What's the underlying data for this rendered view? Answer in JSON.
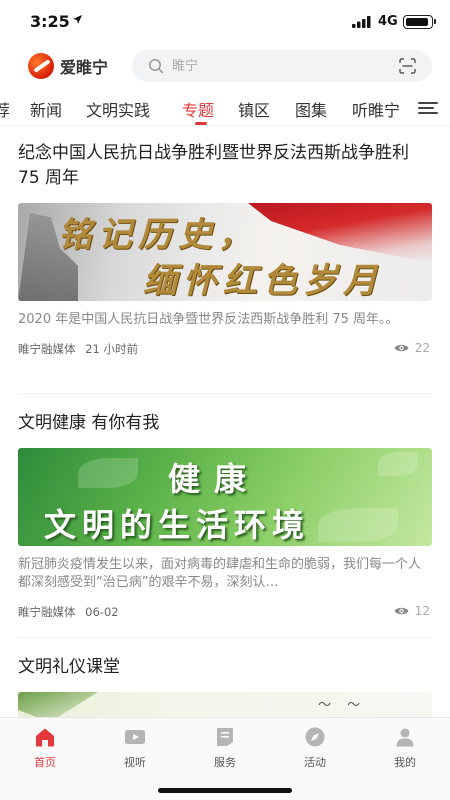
{
  "status_bar": {
    "time": "3:25",
    "network": "4G"
  },
  "header": {
    "logo_text": "爱睢宁",
    "search": {
      "placeholder": "睢宁"
    }
  },
  "tabs": [
    {
      "label": "荐",
      "active": false
    },
    {
      "label": "新闻",
      "active": false
    },
    {
      "label": "文明实践",
      "active": false
    },
    {
      "label": "专题",
      "active": true
    },
    {
      "label": "镇区",
      "active": false
    },
    {
      "label": "图集",
      "active": false
    },
    {
      "label": "听睢宁",
      "active": false
    }
  ],
  "articles": [
    {
      "title": "纪念中国人民抗日战争胜利暨世界反法西斯战争胜利 75 周年",
      "image_text": [
        "铭记历史，",
        "缅怀红色岁月"
      ],
      "description": "2020 年是中国人民抗日战争暨世界反法西斯战争胜利 75 周年。。",
      "source": "睢宁融媒体",
      "time": "21 小时前",
      "views": "22"
    },
    {
      "title": "文明健康 有你有我",
      "image_text": [
        "健康",
        "文明的生活环境"
      ],
      "description": "新冠肺炎疫情发生以来，面对病毒的肆虐和生命的脆弱，我们每一个人都深刻感受到“治已病”的艰辛不易，深刻认…",
      "source": "睢宁融媒体",
      "time": "06-02",
      "views": "12"
    },
    {
      "title": "文明礼仪课堂"
    }
  ],
  "bottom_nav": [
    {
      "label": "首页",
      "icon": "home-icon",
      "active": true
    },
    {
      "label": "视听",
      "icon": "video-play-icon",
      "active": false
    },
    {
      "label": "服务",
      "icon": "service-icon",
      "active": false
    },
    {
      "label": "活动",
      "icon": "compass-icon",
      "active": false
    },
    {
      "label": "我的",
      "icon": "user-icon",
      "active": false
    }
  ],
  "colors": {
    "accent": "#e4393c",
    "text_primary": "#222222",
    "text_secondary": "#888888"
  }
}
